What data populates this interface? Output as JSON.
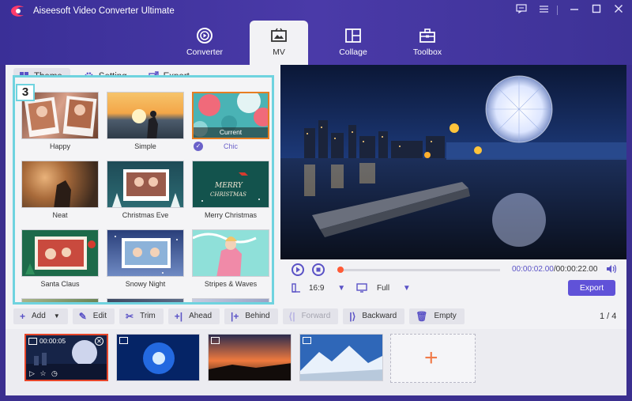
{
  "app": {
    "title": "Aiseesoft Video Converter Ultimate"
  },
  "window": {
    "controls": [
      "chat-icon",
      "menu-icon",
      "minimize-icon",
      "maximize-icon",
      "close-icon"
    ]
  },
  "nav": [
    {
      "label": "Converter",
      "icon": "converter-icon"
    },
    {
      "label": "MV",
      "icon": "mv-icon",
      "active": true
    },
    {
      "label": "Collage",
      "icon": "collage-icon"
    },
    {
      "label": "Toolbox",
      "icon": "toolbox-icon"
    }
  ],
  "left_tabs": [
    {
      "label": "Theme",
      "icon": "theme-icon",
      "active": true
    },
    {
      "label": "Setting",
      "icon": "gear-icon"
    },
    {
      "label": "Export",
      "icon": "export-icon"
    }
  ],
  "step_badge": "3",
  "themes": [
    {
      "label": "Happy"
    },
    {
      "label": "Simple"
    },
    {
      "label": "Chic",
      "selected": true,
      "tag": "Current"
    },
    {
      "label": "Neat"
    },
    {
      "label": "Christmas Eve"
    },
    {
      "label": "Merry Christmas"
    },
    {
      "label": "Santa Claus"
    },
    {
      "label": "Snowy Night"
    },
    {
      "label": "Stripes & Waves"
    }
  ],
  "player": {
    "current_time": "00:00:02.00",
    "total_time": "/00:00:22.00",
    "aspect": "16:9",
    "fit": "Full",
    "export_label": "Export",
    "progress": 0.0
  },
  "toolbar": [
    {
      "label": "Add",
      "icon": "plus-icon",
      "dropdown": true
    },
    {
      "label": "Edit",
      "icon": "edit-icon"
    },
    {
      "label": "Trim",
      "icon": "scissors-icon"
    },
    {
      "label": "Ahead",
      "icon": "ahead-icon"
    },
    {
      "label": "Behind",
      "icon": "behind-icon"
    },
    {
      "label": "Forward",
      "icon": "forward-icon",
      "disabled": true
    },
    {
      "label": "Backward",
      "icon": "backward-icon"
    },
    {
      "label": "Empty",
      "icon": "trash-icon"
    }
  ],
  "page_count": "1 / 4",
  "clips": [
    {
      "time": "00:00:05",
      "selected": true
    },
    {
      "time": ""
    },
    {
      "time": ""
    },
    {
      "time": ""
    }
  ],
  "colors": {
    "accent": "#6052d8",
    "highlight": "#6fd3df",
    "selection": "#e67e22",
    "header": "#3b2f8f"
  }
}
